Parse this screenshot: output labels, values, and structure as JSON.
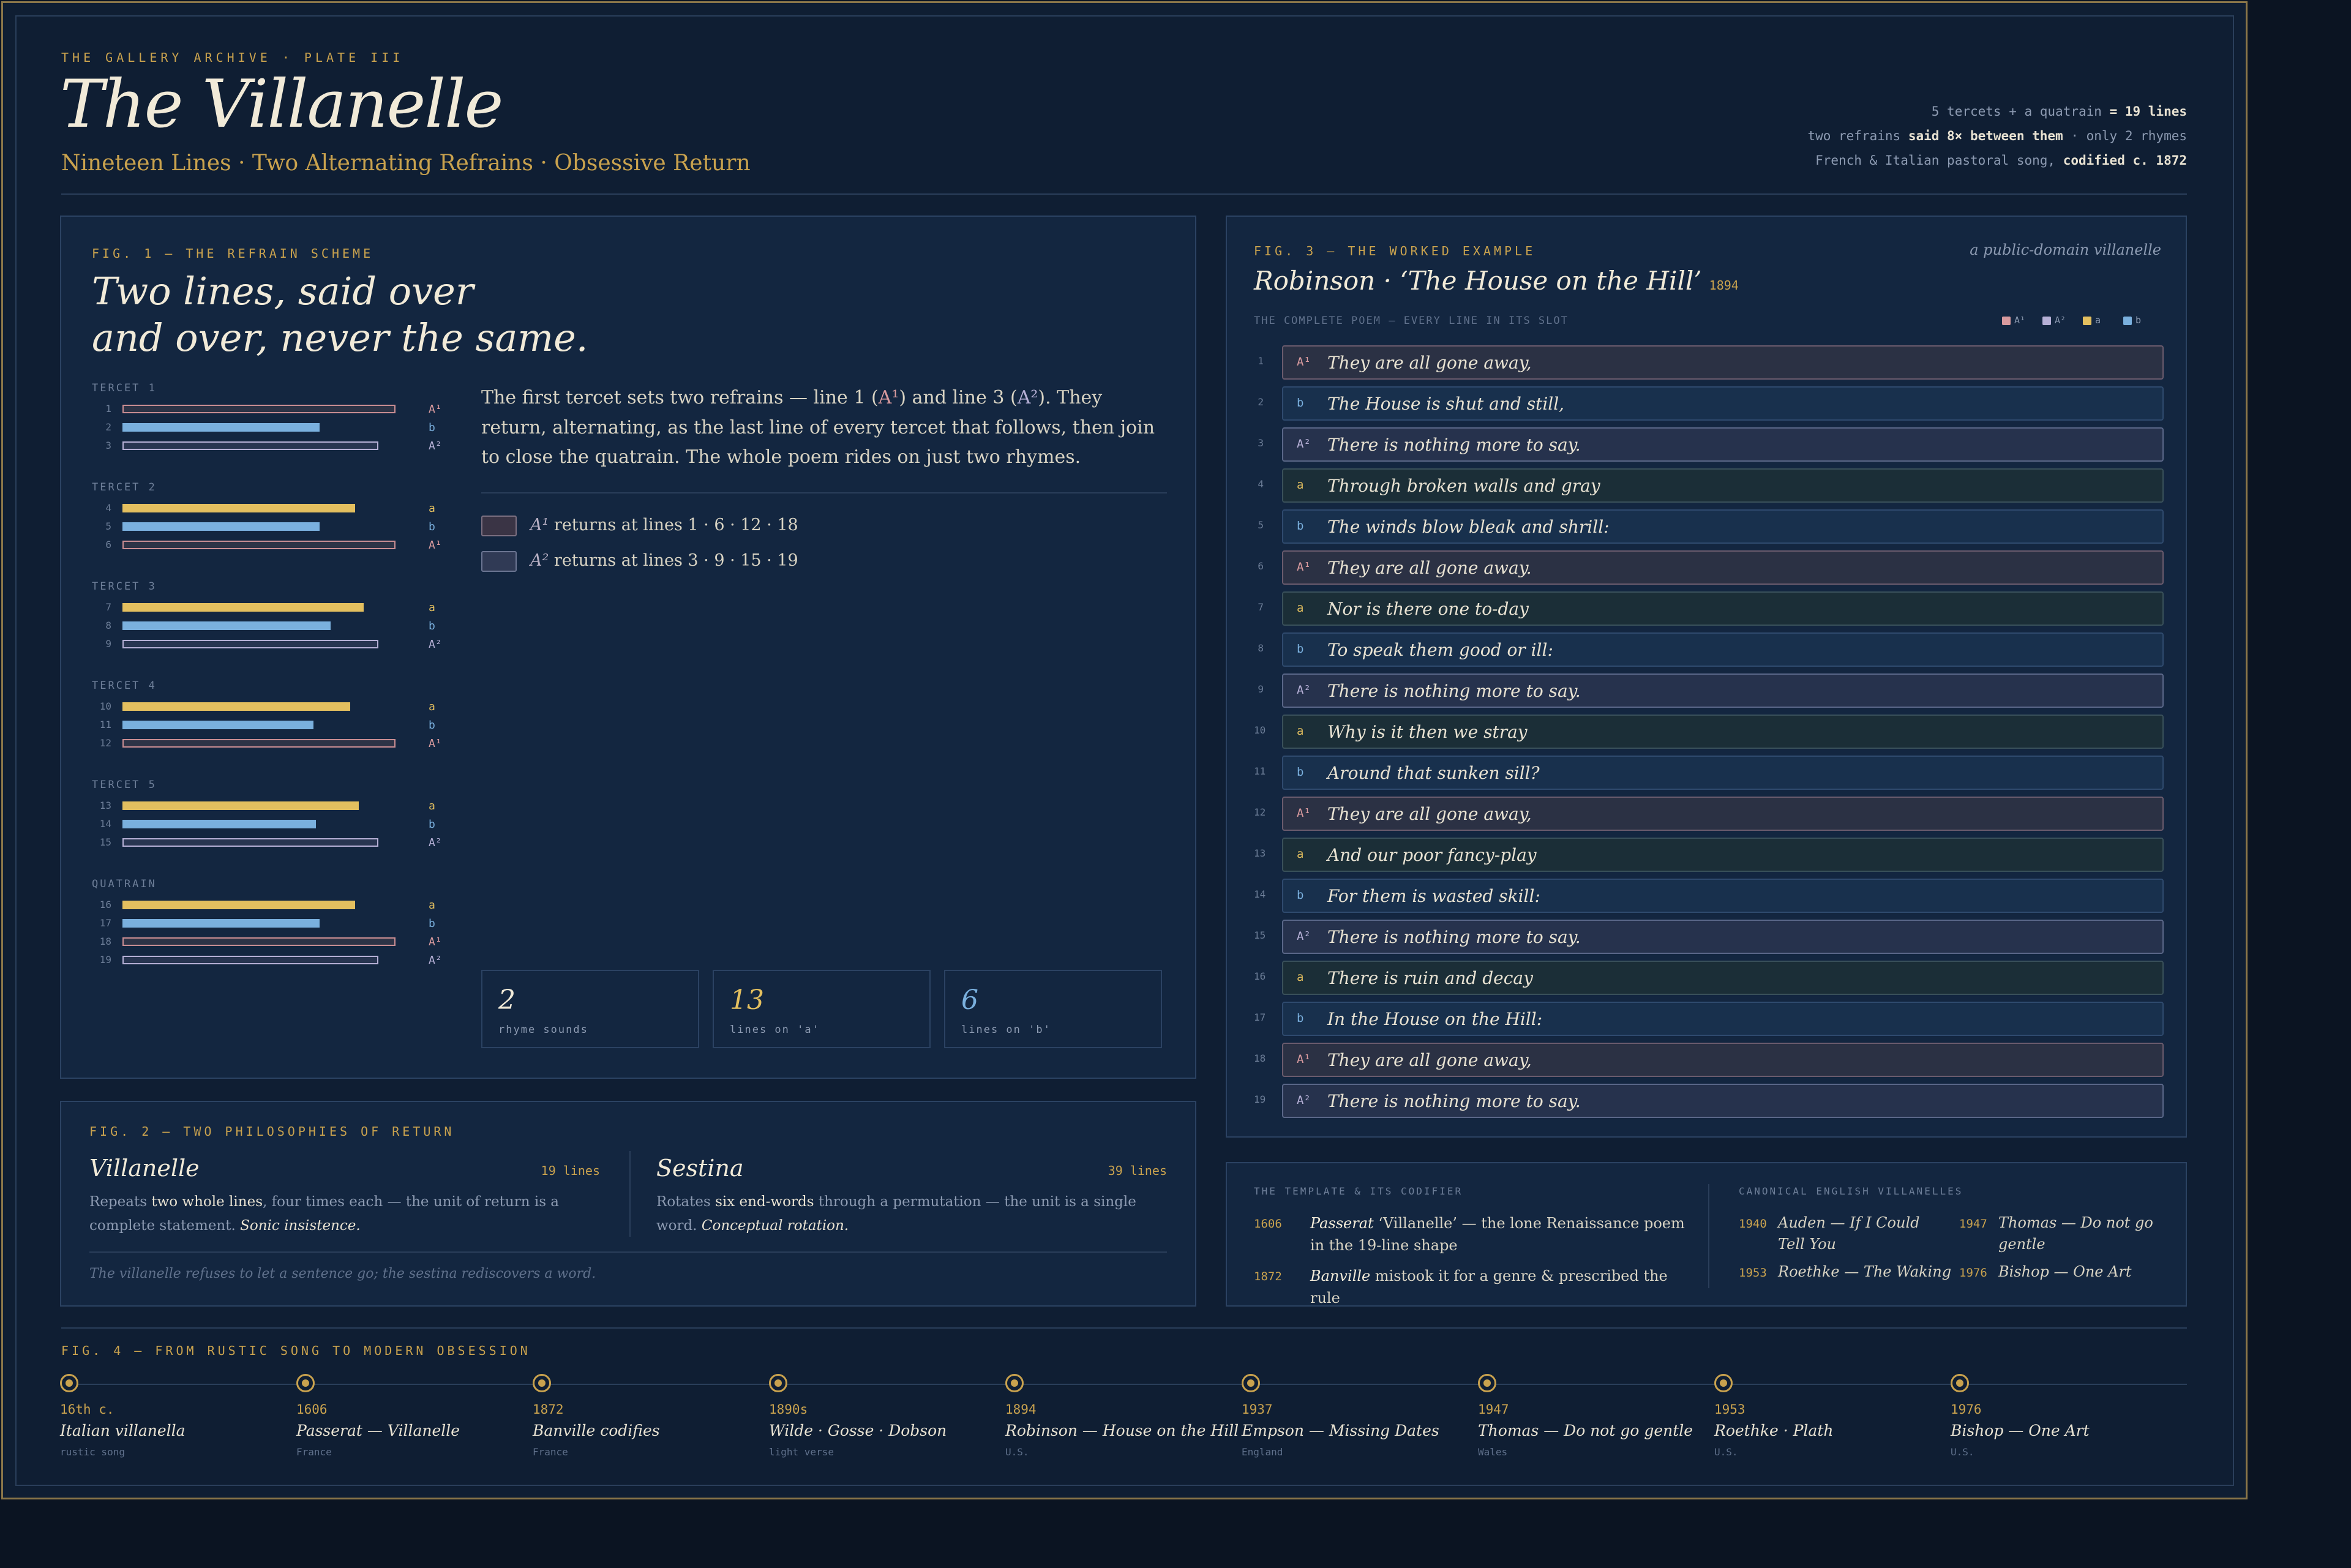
{
  "header": {
    "kicker": "THE GALLERY ARCHIVE · PLATE III",
    "title": "The Villanelle",
    "subtitle": "Nineteen Lines · Two Alternating Refrains · Obsessive Return",
    "stats": [
      {
        "pre": "5 tercets + a quatrain ",
        "strong": "= 19 lines",
        "post": ""
      },
      {
        "pre": "two refrains ",
        "strong": "said 8× between them",
        "post": " · only 2 rhymes"
      },
      {
        "pre": "French & Italian pastoral song, ",
        "strong": "codified c. 1872",
        "post": ""
      }
    ]
  },
  "colors": {
    "A1": "#d89a9e",
    "A2": "#b6b0d6",
    "a": "#e3bf5f",
    "b": "#7ab0de",
    "accent": "#c9a24e"
  },
  "fig1": {
    "label": "FIG. 1 — THE REFRAIN SCHEME",
    "title_line1": "Two lines, said over",
    "title_line2": "and over, never the same.",
    "desc_part1": "The first tercet sets two refrains — line 1 (",
    "ref1": "A¹",
    "desc_part2": ") and line 3 (",
    "ref2": "A²",
    "desc_part3": "). They return, alternating, as the last line of every tercet that follows, then join to close the quatrain. The whole poem rides on just two rhymes.",
    "legend": [
      {
        "sym": "A¹",
        "text": "returns at lines 1 · 6 · 12 · 18"
      },
      {
        "sym": "A²",
        "text": "returns at lines 3 · 9 · 15 · 19"
      }
    ],
    "groups": [
      {
        "label": "TERCET 1",
        "lines": [
          1,
          2,
          3
        ]
      },
      {
        "label": "TERCET 2",
        "lines": [
          4,
          5,
          6
        ]
      },
      {
        "label": "TERCET 3",
        "lines": [
          7,
          8,
          9
        ]
      },
      {
        "label": "TERCET 4",
        "lines": [
          10,
          11,
          12
        ]
      },
      {
        "label": "TERCET 5",
        "lines": [
          13,
          14,
          15
        ]
      },
      {
        "label": "QUATRAIN",
        "lines": [
          16,
          17,
          18,
          19
        ]
      }
    ],
    "stats": [
      {
        "value": "2",
        "label": "rhyme sounds"
      },
      {
        "value": "13",
        "label": "lines on 'a'"
      },
      {
        "value": "6",
        "label": "lines on 'b'"
      }
    ]
  },
  "fig2": {
    "label": "FIG. 2 — TWO PHILOSOPHIES OF RETURN",
    "left": {
      "title": "Villanelle",
      "count": "19 lines",
      "pre": "Repeats ",
      "strong": "two whole lines",
      "mid": ", four times each — the unit of return is a complete statement. ",
      "em": "Sonic insistence."
    },
    "right": {
      "title": "Sestina",
      "count": "39 lines",
      "pre": "Rotates ",
      "strong": "six end-words",
      "mid": " through a permutation — the unit is a single word. ",
      "em": "Conceptual rotation."
    },
    "footer": "The villanelle refuses to let a sentence go; the sestina rediscovers a word."
  },
  "fig3": {
    "label": "FIG. 3 — THE WORKED EXAMPLE",
    "note": "a public-domain villanelle",
    "title": "Robinson · ‘The House on the Hill’",
    "year": "1894",
    "subtitle": "THE COMPLETE POEM — EVERY LINE IN ITS SLOT",
    "legend": [
      {
        "key": "A1",
        "label": "A¹"
      },
      {
        "key": "A2",
        "label": "A²"
      },
      {
        "key": "a",
        "label": "a"
      },
      {
        "key": "b",
        "label": "b"
      }
    ],
    "poem": [
      {
        "n": "1",
        "k": "A1",
        "tag": "A¹",
        "text": "They are all gone away,"
      },
      {
        "n": "2",
        "k": "b",
        "tag": "b",
        "text": "The House is shut and still,"
      },
      {
        "n": "3",
        "k": "A2",
        "tag": "A²",
        "text": "There is nothing more to say."
      },
      {
        "n": "4",
        "k": "a",
        "tag": "a",
        "text": "Through broken walls and gray"
      },
      {
        "n": "5",
        "k": "b",
        "tag": "b",
        "text": "The winds blow bleak and shrill:"
      },
      {
        "n": "6",
        "k": "A1",
        "tag": "A¹",
        "text": "They are all gone away."
      },
      {
        "n": "7",
        "k": "a",
        "tag": "a",
        "text": "Nor is there one to-day"
      },
      {
        "n": "8",
        "k": "b",
        "tag": "b",
        "text": "To speak them good or ill:"
      },
      {
        "n": "9",
        "k": "A2",
        "tag": "A²",
        "text": "There is nothing more to say."
      },
      {
        "n": "10",
        "k": "a",
        "tag": "a",
        "text": "Why is it then we stray"
      },
      {
        "n": "11",
        "k": "b",
        "tag": "b",
        "text": "Around that sunken sill?"
      },
      {
        "n": "12",
        "k": "A1",
        "tag": "A¹",
        "text": "They are all gone away,"
      },
      {
        "n": "13",
        "k": "a",
        "tag": "a",
        "text": "And our poor fancy-play"
      },
      {
        "n": "14",
        "k": "b",
        "tag": "b",
        "text": "For them is wasted skill:"
      },
      {
        "n": "15",
        "k": "A2",
        "tag": "A²",
        "text": "There is nothing more to say."
      },
      {
        "n": "16",
        "k": "a",
        "tag": "a",
        "text": "There is ruin and decay"
      },
      {
        "n": "17",
        "k": "b",
        "tag": "b",
        "text": "In the House on the Hill:"
      },
      {
        "n": "18",
        "k": "A1",
        "tag": "A¹",
        "text": "They are all gone away,"
      },
      {
        "n": "19",
        "k": "A2",
        "tag": "A²",
        "text": "There is nothing more to say."
      }
    ]
  },
  "template": {
    "header_left": "THE TEMPLATE & ITS CODIFIER",
    "header_right": "CANONICAL ENGLISH VILLANELLES",
    "entries": [
      {
        "year": "1606",
        "em": "Passerat",
        "text": " ‘Villanelle’ — the lone Renaissance poem in the 19-line shape"
      },
      {
        "year": "1872",
        "em": "Banville",
        "text": " mistook it for a genre & prescribed the rule"
      }
    ],
    "canon": [
      {
        "year": "1940",
        "text": "Auden — If I Could Tell You"
      },
      {
        "year": "1947",
        "text": "Thomas — Do not go gentle"
      },
      {
        "year": "1953",
        "text": "Roethke — The Waking"
      },
      {
        "year": "1976",
        "text": "Bishop — One Art"
      }
    ]
  },
  "fig4": {
    "label": "FIG. 4 — FROM RUSTIC SONG TO MODERN OBSESSION",
    "events": [
      {
        "year": "16th c.",
        "name": "Italian villanella",
        "place": "rustic song"
      },
      {
        "year": "1606",
        "name": "Passerat — Villanelle",
        "place": "France"
      },
      {
        "year": "1872",
        "name": "Banville codifies",
        "place": "France"
      },
      {
        "year": "1890s",
        "name": "Wilde · Gosse · Dobson",
        "place": "light verse"
      },
      {
        "year": "1894",
        "name": "Robinson — House on the Hill",
        "place": "U.S."
      },
      {
        "year": "1937",
        "name": "Empson — Missing Dates",
        "place": "England"
      },
      {
        "year": "1947",
        "name": "Thomas — Do not go gentle",
        "place": "Wales"
      },
      {
        "year": "1953",
        "name": "Roethke · Plath",
        "place": "U.S."
      },
      {
        "year": "1976",
        "name": "Bishop — One Art",
        "place": "U.S."
      }
    ]
  }
}
